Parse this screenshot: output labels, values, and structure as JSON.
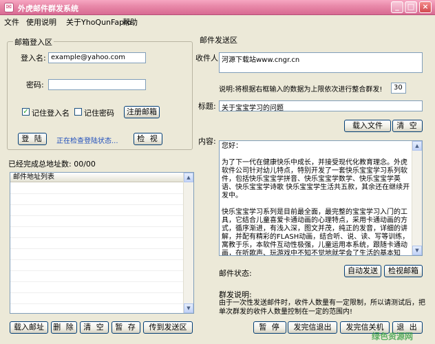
{
  "window": {
    "title": "外虎邮件群发系统",
    "buttons": {
      "minimize": "_",
      "maximize": "□",
      "close": "×"
    }
  },
  "menu": [
    "文件",
    "使用说明",
    "关于YhoQunFapro",
    "帮助"
  ],
  "login": {
    "group_title": "邮箱登入区",
    "username_label": "登入名:",
    "username_value": "example@yahoo.com",
    "password_label": "密码:",
    "password_value": "",
    "remember_user_label": "记住登入名",
    "remember_user_checked": "✓",
    "remember_pass_label": "记住密码",
    "register_button": "注册邮箱",
    "login_button": "登 陆",
    "status_text": "正在检查登陆状态...",
    "view_button": "检 视"
  },
  "addresses": {
    "count_label": "已经完成总地址数: 00/00",
    "list_header": "邮件地址列表",
    "buttons": [
      "载入邮址",
      "删 除",
      "清 空",
      "暂 存",
      "传到发送区"
    ]
  },
  "send": {
    "group_title": "邮件发送区",
    "recipient_label": "收件人:",
    "recipient_value": "河源下载站www.cngr.cn",
    "note_text": "说明:将根据右框输入的数据为上限依次进行整合群发!",
    "batch_value": "30",
    "subject_label": "标题:",
    "subject_value": "关于宝宝学习的问题",
    "load_file_button": "载入文件",
    "clear_button": "清 空",
    "content_label": "内容:",
    "content_text": "您好：\n\n为了下一代在健康快乐中成长，并接受现代化教育理念。外虎软件公司针对幼儿特点，特别开发了一套快乐宝宝学习系列软件，包括快乐宝宝学拼音、快乐宝宝学数学、快乐宝宝学英语、快乐宝宝学诗歌 快乐宝宝学生活共五款，其余还在继续开发中。\n\n快乐宝宝学习系列是目前最全面，最完整的宝宝学习入门的工具，它结合儿童喜爱卡通动画的心理特点，采用卡通动画的方式，循序渐进，有浅入深，图文并茂，纯正的发音，详细的讲解，并配有精彩的FLASH动画，结合听、说、读、写等训练，寓教于乐，本软件互动性极强，儿童运用本系统，跟随卡通动画，在听歌声、玩游戏中不知不觉地就学会了生活的基本知识，基础技能，达到自己能看，能说，能算的水平，是学前儿童学习的最佳工具。本软件对儿童认知能力、计算机操作能力、思维想象能力都有一定帮助!",
    "status_label": "邮件状态:",
    "auto_send_button": "自动发送",
    "check_mail_button": "检视邮箱",
    "mass_note_label": "群发说明:",
    "mass_note_text": "由于一次性发送邮件时，收件人数量有一定限制，所以请测试后，把单次群发的收件人数量控制在一定的范围内!"
  },
  "bottom_buttons": [
    "暂 停",
    "发完信退出",
    "发完信关机",
    "退 出"
  ],
  "watermark": "绿色资源网"
}
